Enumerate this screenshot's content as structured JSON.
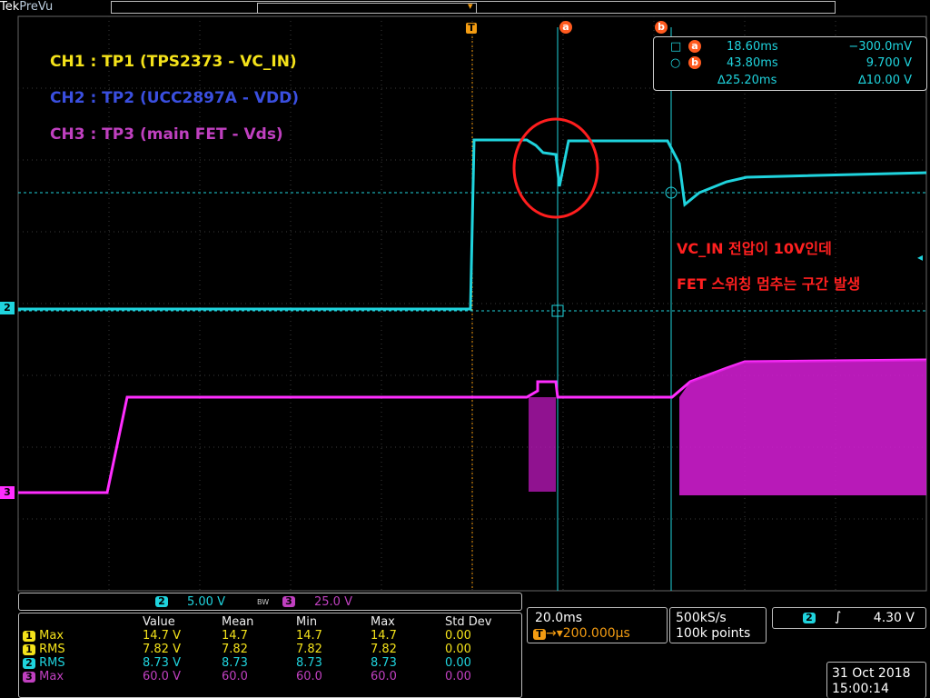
{
  "header": {
    "brand": "Tek",
    "mode": "PreVu"
  },
  "markers": {
    "trigger": "T",
    "cursor_a": "a",
    "cursor_b": "b"
  },
  "channel_labels": [
    {
      "text": "CH1 : TP1 (TPS2373 - VC_IN)",
      "color": "#f4e21a"
    },
    {
      "text": "CH2 : TP2 (UCC2897A - VDD)",
      "color": "#3a4fe0"
    },
    {
      "text": "CH3 : TP3 (main FET - Vds)",
      "color": "#c040c0"
    }
  ],
  "annotation": {
    "line1": "VC_IN 전압이 10V인데",
    "line2": "FET 스위칭 멈추는 구간 발생"
  },
  "cursor_readout": {
    "a": {
      "time": "18.60ms",
      "value": "−300.0mV"
    },
    "b": {
      "time": "43.80ms",
      "value": "9.700 V"
    },
    "delta": {
      "time": "∆25.20ms",
      "value": "∆10.00 V"
    }
  },
  "scale_bar": {
    "ch2": {
      "num": "2",
      "scale": "5.00 V"
    },
    "bw": "BW",
    "ch3": {
      "num": "3",
      "scale": "25.0 V"
    }
  },
  "measurements": {
    "headers": [
      "Value",
      "Mean",
      "Min",
      "Max",
      "Std Dev"
    ],
    "rows": [
      {
        "ch": "1",
        "name": "Max",
        "value": "14.7 V",
        "mean": "14.7",
        "min": "14.7",
        "max": "14.7",
        "std": "0.00",
        "color": "#f4e21a"
      },
      {
        "ch": "1",
        "name": "RMS",
        "value": "7.82 V",
        "mean": "7.82",
        "min": "7.82",
        "max": "7.82",
        "std": "0.00",
        "color": "#f4e21a"
      },
      {
        "ch": "2",
        "name": "RMS",
        "value": "8.73 V",
        "mean": "8.73",
        "min": "8.73",
        "max": "8.73",
        "std": "0.00",
        "color": "#1fd3dd"
      },
      {
        "ch": "3",
        "name": "Max",
        "value": "60.0 V",
        "mean": "60.0",
        "min": "60.0",
        "max": "60.0",
        "std": "0.00",
        "color": "#c040c0"
      }
    ]
  },
  "timebase": {
    "scale": "20.0ms",
    "position": "→▾200.000µs"
  },
  "sampling": {
    "rate": "500kS/s",
    "points": "100k points"
  },
  "trigger": {
    "ch": "2",
    "slope": "∫",
    "level": "4.30 V"
  },
  "datetime": {
    "date": "31 Oct  2018",
    "time": "15:00:14"
  },
  "edge_labels": {
    "ch2": "2",
    "ch3": "3"
  },
  "colors": {
    "ch1": "#f4e21a",
    "ch2": "#1fd3dd",
    "ch3": "#ff2dff",
    "grid": "#555",
    "annotation": "#ff2020"
  }
}
